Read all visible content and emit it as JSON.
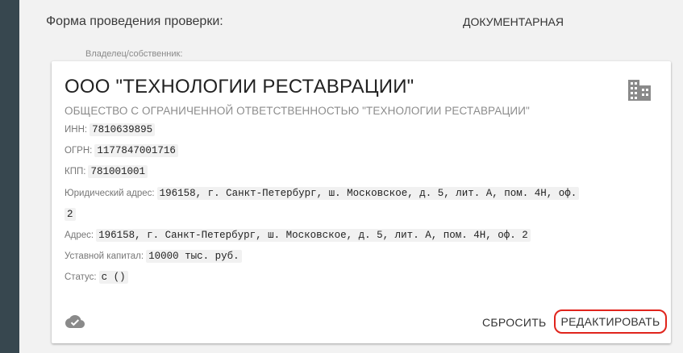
{
  "inspection": {
    "form_label": "Форма проведения проверки:",
    "form_value": "ДОКУМЕНТАРНАЯ"
  },
  "owner_label": "Владелец/собственник:",
  "company": {
    "short_name": "ООО \"ТЕХНОЛОГИИ РЕСТАВРАЦИИ\"",
    "full_name": "ОБЩЕСТВО С ОГРАНИЧЕННОЙ ОТВЕТСТВЕННОСТЬЮ \"ТЕХНОЛОГИИ РЕСТАВРАЦИИ\"",
    "inn_label": "ИНН:",
    "inn": "7810639895",
    "ogrn_label": "ОГРН:",
    "ogrn": "1177847001716",
    "kpp_label": "КПП:",
    "kpp": "781001001",
    "legal_address_label": "Юридический адрес:",
    "legal_address_line1": "196158, г. Санкт-Петербург, ш. Московское, д. 5, лит. А, пом. 4Н, оф.",
    "legal_address_line2": "2",
    "address_label": "Адрес:",
    "address": "196158, г. Санкт-Петербург, ш. Московское, д. 5, лит. А, пом. 4Н, оф. 2",
    "capital_label": "Уставной капитал:",
    "capital": "10000 тыс. руб.",
    "status_label": "Статус:",
    "status": "с ()"
  },
  "actions": {
    "reset_label": "СБРОСИТЬ",
    "edit_label": "РЕДАКТИРОВАТЬ"
  },
  "icons": {
    "building": "building-icon",
    "cloud": "cloud-done-icon"
  },
  "colors": {
    "sidebar": "#37474f",
    "highlight": "#e0241c"
  }
}
